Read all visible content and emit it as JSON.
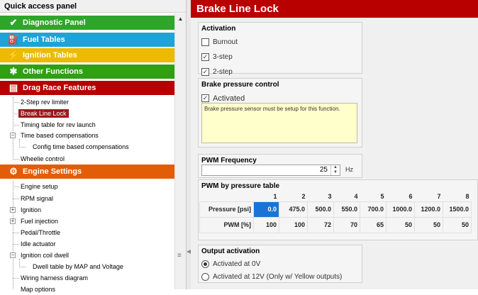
{
  "left": {
    "title": "Quick access panel",
    "categories": {
      "diagnostic": "Diagnostic Panel",
      "fuel": "Fuel Tables",
      "ignition": "Ignition Tables",
      "other": "Other Functions",
      "drag": "Drag Race Features",
      "engine": "Engine Settings"
    },
    "drag_items": [
      "2-Step rev limiter",
      "Break Line Lock",
      "Timing table for rev launch",
      "Time based compensations",
      "Config time based compensations",
      "Wheelie control"
    ],
    "engine_items": [
      "Engine setup",
      "RPM signal",
      "Ignition",
      "Fuel injection",
      "Pedal/Throttle",
      "Idle actuator",
      "Ignition coil dwell",
      "Dwell table by MAP and Voltage",
      "Wiring harness diagram",
      "Map options"
    ],
    "selected": "Break Line Lock"
  },
  "right": {
    "title": "Brake Line Lock",
    "activation": {
      "title": "Activation",
      "options": [
        {
          "label": "Burnout",
          "checked": false
        },
        {
          "label": "3-step",
          "checked": true
        },
        {
          "label": "2-step",
          "checked": true
        }
      ]
    },
    "brake": {
      "title": "Brake pressure control",
      "activated_label": "Activated",
      "activated": true,
      "note": "Brake pressure sensor must be setup for this function."
    },
    "pwm_freq": {
      "title": "PWM Frequency",
      "value": "25",
      "unit": "Hz"
    },
    "pwm_table": {
      "title": "PWM by pressure table",
      "columns": [
        "1",
        "2",
        "3",
        "4",
        "5",
        "6",
        "7",
        "8"
      ],
      "row1_label": "Pressure [psi]",
      "row1": [
        "0.0",
        "475.0",
        "500.0",
        "550.0",
        "700.0",
        "1000.0",
        "1200.0",
        "1500.0"
      ],
      "row2_label": "PWM [%]",
      "row2": [
        "100",
        "100",
        "72",
        "70",
        "65",
        "50",
        "50",
        "50"
      ]
    },
    "output": {
      "title": "Output activation",
      "options": [
        {
          "label": "Activated at 0V",
          "selected": true
        },
        {
          "label": "Activated at 12V (Only w/ Yellow outputs)",
          "selected": false
        }
      ]
    }
  },
  "colors": {
    "title_red": "#b90000",
    "diagnostic": "#2fa52b",
    "fuel": "#1ea3d6",
    "ignition": "#ecba00",
    "other": "#2f9f14",
    "drag": "#b70000",
    "engine": "#e35c07",
    "selection": "#1a74d6"
  },
  "icons": [
    "wrench-icon",
    "fuel-icon",
    "spark-icon",
    "function-icon",
    "drag-icon",
    "engine-icon"
  ]
}
